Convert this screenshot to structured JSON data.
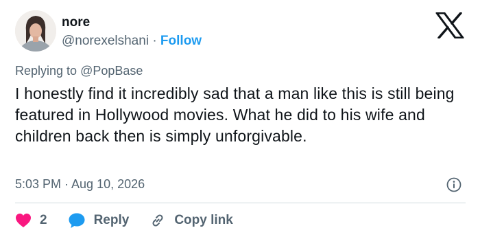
{
  "author": {
    "name": "nore",
    "handle": "@norexelshani",
    "separator": "·",
    "follow_label": "Follow",
    "avatar_icon": "user-avatar"
  },
  "platform_icon": "x-logo-icon",
  "reply_context": {
    "prefix": "Replying to",
    "target": "@PopBase"
  },
  "tweet": {
    "text": "I honestly find it incredibly sad that a man like this is still being featured in Hollywood movies. What he did to his wife and children back then is simply unforgivable.",
    "timestamp": "5:03 PM · Aug 10, 2026"
  },
  "actions": {
    "like_count": "2",
    "reply_label": "Reply",
    "copy_label": "Copy link"
  },
  "colors": {
    "accent": "#1d9bf0",
    "like": "#f91880",
    "text": "#0f1419",
    "muted": "#536471"
  }
}
